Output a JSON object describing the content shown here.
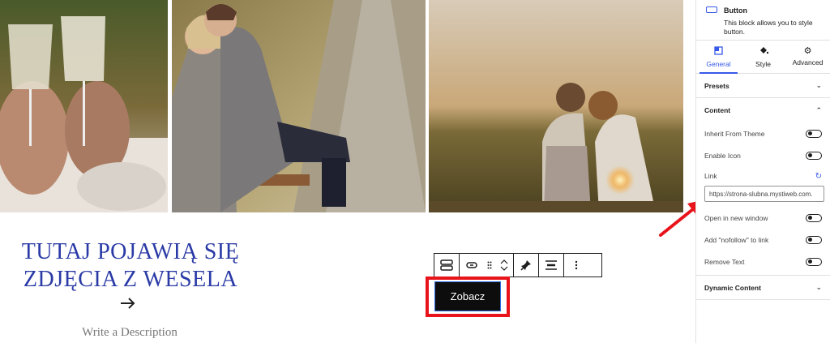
{
  "canvas": {
    "heading_line1": "TUTAJ POJAWIĄ SIĘ",
    "heading_line2": "ZDJĘCIA Z WESELA",
    "arrow_icon": "arrow-right-icon",
    "description": "Write a Description",
    "photos": [
      "couple-toasting-photo",
      "couple-on-bench-photo",
      "couple-at-sunset-photo"
    ],
    "button_label": "Zobacz"
  },
  "toolbar": {
    "icons": [
      "button-block-icon",
      "link-icon",
      "drag-handle-icon",
      "move-up-icon",
      "move-down-icon",
      "pin-icon",
      "align-center-icon",
      "more-options-icon"
    ]
  },
  "sidebar": {
    "block_title": "Button",
    "block_description": "This block allows you to style button.",
    "tabs": [
      {
        "label": "General",
        "icon": "general-icon"
      },
      {
        "label": "Style",
        "icon": "style-icon"
      },
      {
        "label": "Advanced",
        "icon": "gear-icon"
      }
    ],
    "presets_label": "Presets",
    "content_label": "Content",
    "inherit_label": "Inherit From Theme",
    "enable_icon_label": "Enable Icon",
    "link_label": "Link",
    "link_value": "https://strona-slubna.mystiweb.com.",
    "new_window_label": "Open in new window",
    "nofollow_label": "Add \"nofollow\" to link",
    "remove_text_label": "Remove Text",
    "dynamic_content_label": "Dynamic Content"
  },
  "colors": {
    "heading": "#2a3aa6",
    "accent": "#3858e9",
    "highlight": "#e8131b",
    "button_bg": "#0d0d0d"
  }
}
